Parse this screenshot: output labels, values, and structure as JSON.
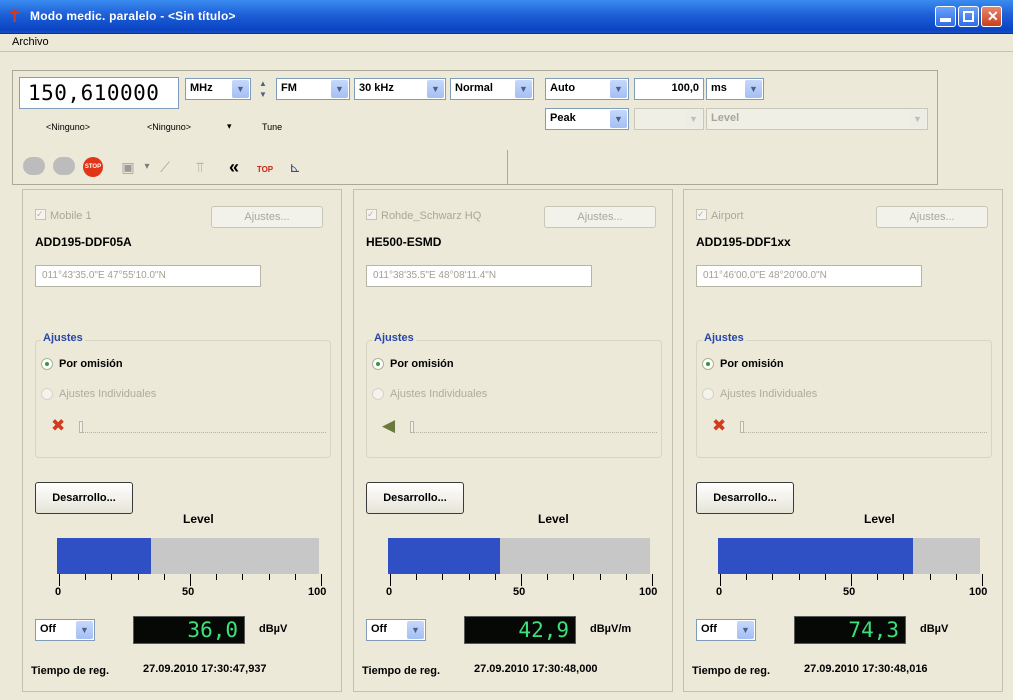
{
  "window": {
    "title": "Modo medic. paralelo  -  <Sin título>"
  },
  "menu": {
    "items": [
      "Archivo"
    ]
  },
  "controls": {
    "frequency": "150,610000",
    "freq_unit": "MHz",
    "demodulation": "FM",
    "bandwidth": "30 kHz",
    "mode": "Normal",
    "measure_mode": "Auto",
    "meas_time": "100,0",
    "time_unit": "ms",
    "detector": "Peak",
    "level_combo": "Level",
    "label_ninguno_1": "<Ninguno>",
    "label_ninguno_2": "<Ninguno>",
    "label_tune": "Tune"
  },
  "toolbar": {
    "icons": [
      "run-icon",
      "pause-icon",
      "stop-icon",
      "save-icon",
      "marker-icon",
      "antenna-icon",
      "rewind-icon",
      "top-icon",
      "chart-icon"
    ],
    "stop_label": "STOP",
    "top_label": "TOP"
  },
  "stations": [
    {
      "name": "Mobile 1",
      "device": "ADD195-DDF05A",
      "coords": "011°43'35.0\"E   47°55'10.0\"N",
      "ajustes_btn": "Ajustes...",
      "group_title": "Ajustes",
      "radio_default": "Por omisión",
      "radio_individual": "Ajustes Individuales",
      "squelch_icon": "mute-icon",
      "desarrollo_btn": "Desarrollo...",
      "level_title": "Level",
      "level_value": 36.0,
      "scale": [
        "0",
        "50",
        "100"
      ],
      "off_combo": "Off",
      "lcd": "36,0",
      "unit": "dBµV",
      "ts_label": "Tiempo de reg.",
      "ts_value": "27.09.2010  17:30:47,937"
    },
    {
      "name": "Rohde_Schwarz HQ",
      "device": "HE500-ESMD",
      "coords": "011°38'35.5\"E   48°08'11.4\"N",
      "ajustes_btn": "Ajustes...",
      "group_title": "Ajustes",
      "radio_default": "Por omisión",
      "radio_individual": "Ajustes Individuales",
      "squelch_icon": "speaker-icon",
      "desarrollo_btn": "Desarrollo...",
      "level_title": "Level",
      "level_value": 42.9,
      "scale": [
        "0",
        "50",
        "100"
      ],
      "off_combo": "Off",
      "lcd": "42,9",
      "unit": "dBµV/m",
      "ts_label": "Tiempo de reg.",
      "ts_value": "27.09.2010  17:30:48,000"
    },
    {
      "name": "Airport",
      "device": "ADD195-DDF1xx",
      "coords": "011°46'00.0\"E   48°20'00.0\"N",
      "ajustes_btn": "Ajustes...",
      "group_title": "Ajustes",
      "radio_default": "Por omisión",
      "radio_individual": "Ajustes Individuales",
      "squelch_icon": "mute-icon",
      "desarrollo_btn": "Desarrollo...",
      "level_title": "Level",
      "level_value": 74.3,
      "scale": [
        "0",
        "50",
        "100"
      ],
      "off_combo": "Off",
      "lcd": "74,3",
      "unit": "dBµV",
      "ts_label": "Tiempo de reg.",
      "ts_value": "27.09.2010  17:30:48,016"
    }
  ]
}
